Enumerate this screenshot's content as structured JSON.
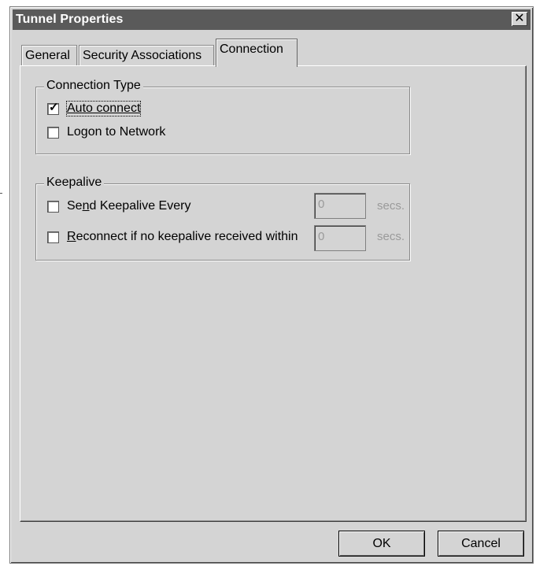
{
  "window": {
    "title": "Tunnel Properties",
    "close_glyph": "✕"
  },
  "tabs": [
    {
      "label": "General"
    },
    {
      "label": "Security Associations"
    },
    {
      "label": "Connection",
      "active": true
    }
  ],
  "connection_type": {
    "legend": "Connection Type",
    "auto_connect": {
      "label": "Auto connect",
      "checked": true
    },
    "logon": {
      "label": "Logon to Network",
      "checked": false
    }
  },
  "keepalive": {
    "legend": "Keepalive",
    "send": {
      "label_pre": "Se",
      "label_u": "n",
      "label_post": "d Keepalive Every",
      "checked": false,
      "value": "0",
      "unit": "secs."
    },
    "reconnect": {
      "label_u": "R",
      "label_post": "econnect if no keepalive received within",
      "checked": false,
      "value": "0",
      "unit": "secs."
    }
  },
  "buttons": {
    "ok": "OK",
    "cancel": "Cancel"
  },
  "icons": {
    "check": "✓"
  }
}
